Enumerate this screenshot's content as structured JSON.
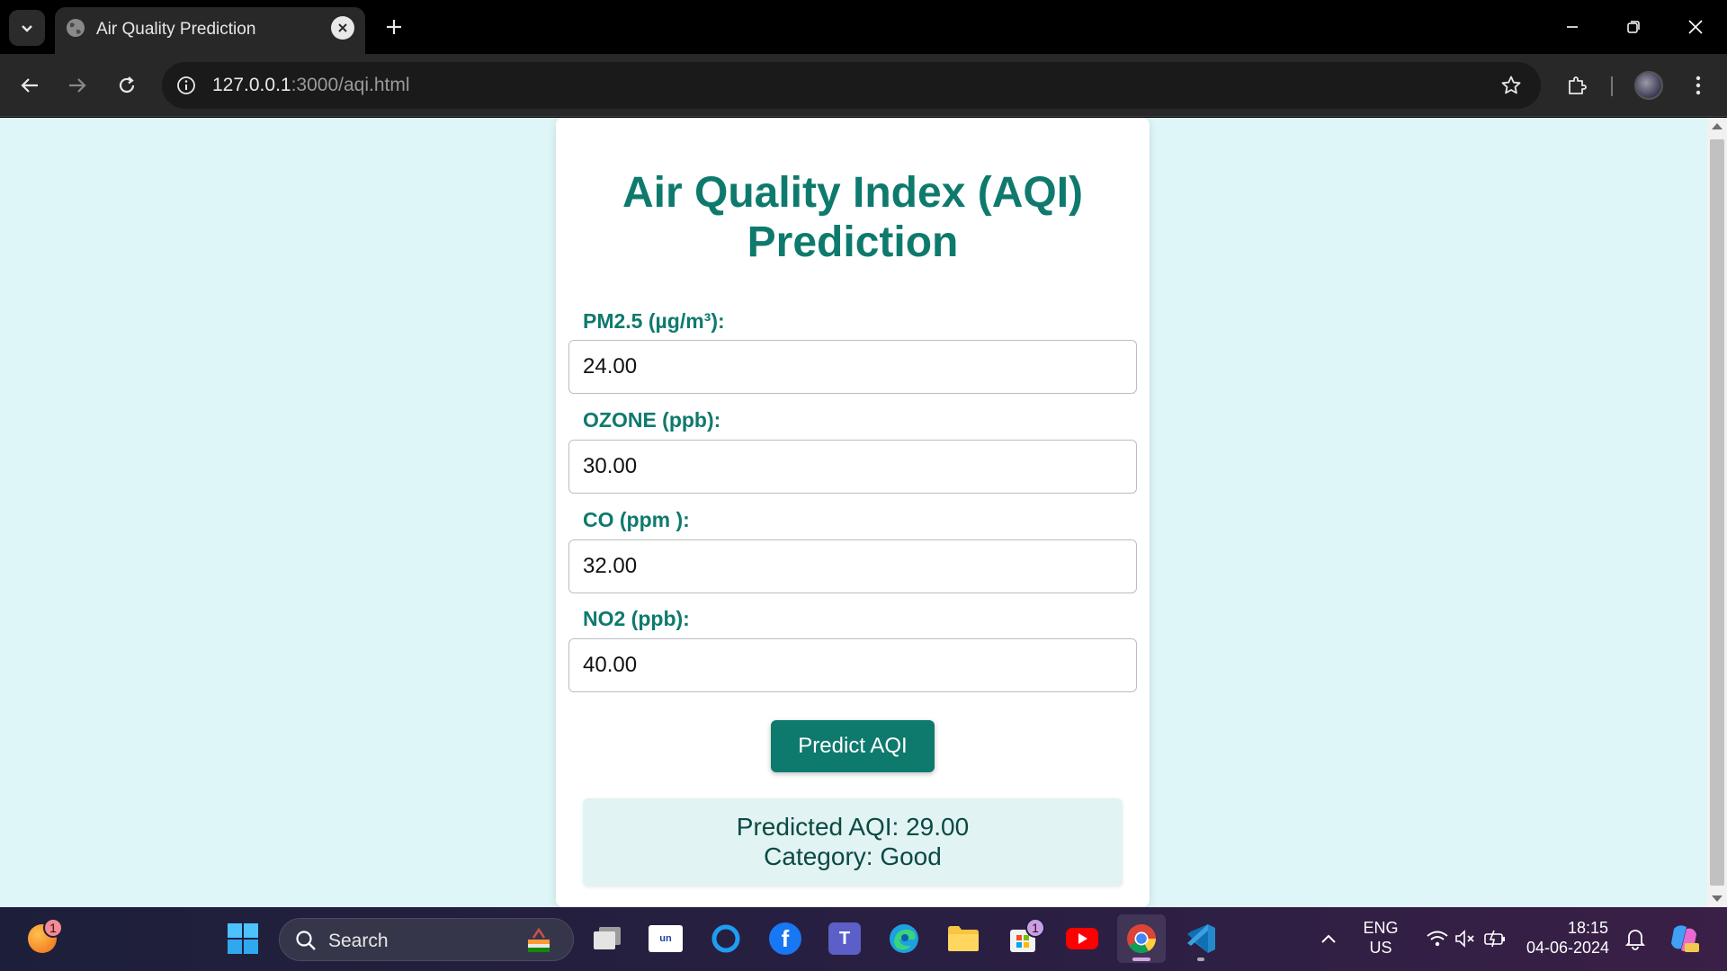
{
  "browser": {
    "tab_title": "Air Quality Prediction",
    "url_host": "127.0.0.1",
    "url_path": ":3000/aqi.html"
  },
  "page": {
    "title": "Air Quality Index (AQI) Prediction",
    "fields": [
      {
        "label": "PM2.5 (µg/m³):",
        "value": "24.00"
      },
      {
        "label": "OZONE (ppb):",
        "value": "30.00"
      },
      {
        "label": "CO (ppm ):",
        "value": "32.00"
      },
      {
        "label": "NO2 (ppb):",
        "value": "40.00"
      }
    ],
    "predict_button": "Predict AQI",
    "result": {
      "aqi_line": "Predicted AQI: 29.00",
      "category_line": "Category: Good"
    }
  },
  "taskbar": {
    "search_placeholder": "Search",
    "widgets_badge": "1",
    "store_badge": "1",
    "language": "ENG",
    "region": "US",
    "time": "18:15",
    "date": "04-06-2024"
  },
  "colors": {
    "accent": "#0e7a6d",
    "page_background": "#dff6f8",
    "result_background": "#e1f3f3"
  }
}
